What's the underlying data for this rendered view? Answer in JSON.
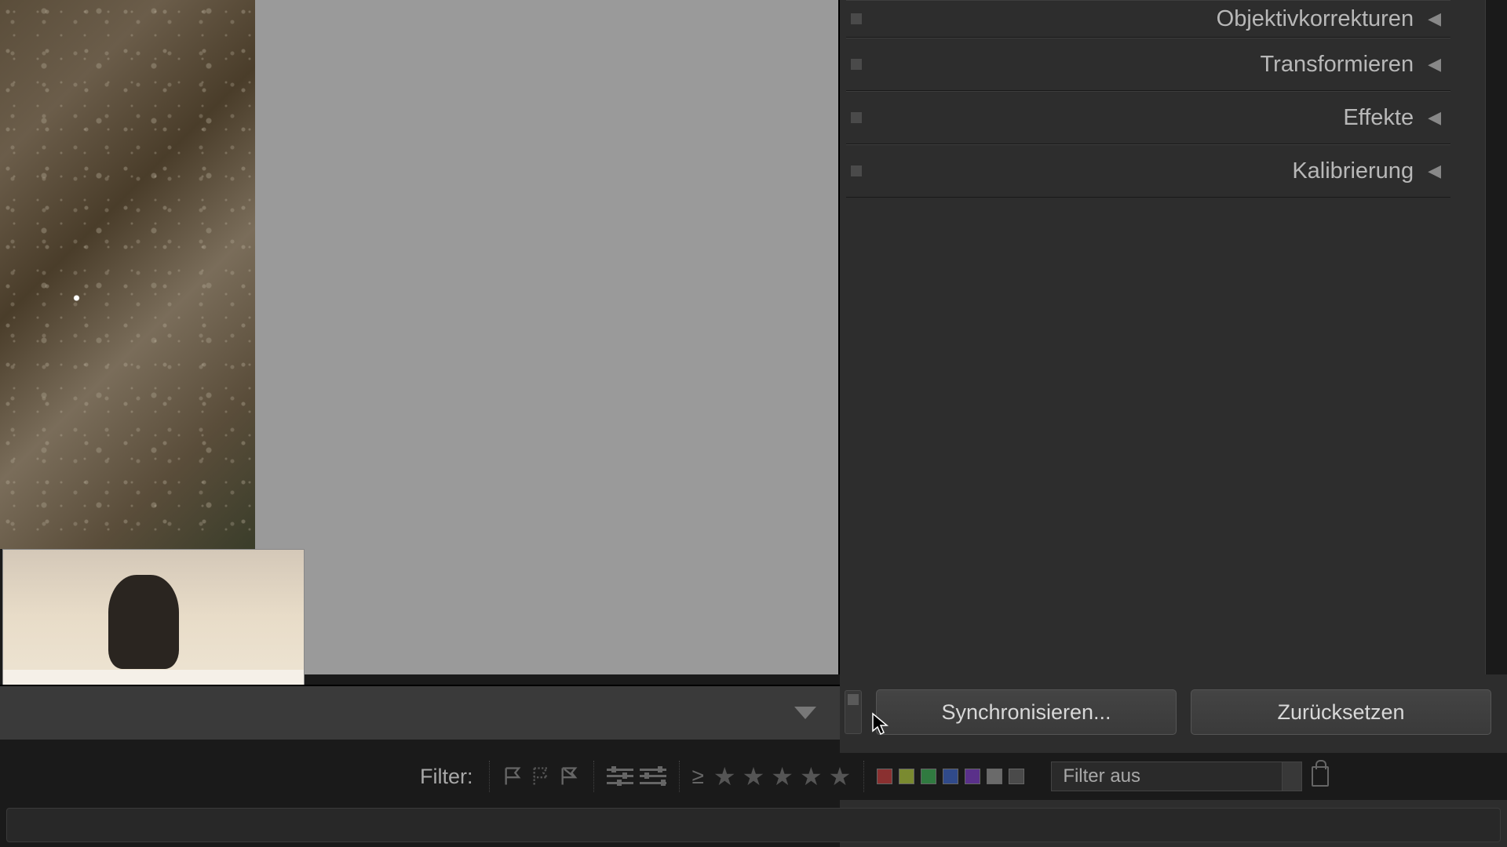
{
  "panels": [
    {
      "label": "Objektivkorrekturen"
    },
    {
      "label": "Transformieren"
    },
    {
      "label": "Effekte"
    },
    {
      "label": "Kalibrierung"
    }
  ],
  "actions": {
    "sync": "Synchronisieren...",
    "reset": "Zurücksetzen"
  },
  "filter": {
    "label": "Filter:",
    "gte": "≥",
    "dropdown": "Filter aus",
    "colors": [
      "#8a3030",
      "#7a8a30",
      "#307a40",
      "#304a8a",
      "#5a308a",
      "#6a6a6a",
      "#4a4a4a"
    ]
  }
}
